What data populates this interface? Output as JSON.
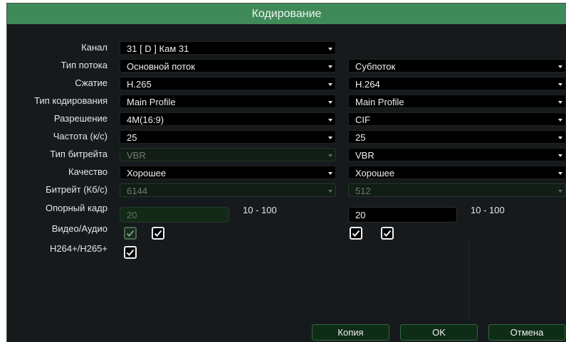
{
  "dialog": {
    "title": "Кодирование"
  },
  "labels": {
    "channel": "Канал",
    "stream_type": "Тип потока",
    "compression": "Сжатие",
    "encoding_type": "Тип кодирования",
    "resolution": "Разрешение",
    "frame_rate": "Частота (к/с)",
    "bitrate_type": "Тип битрейта",
    "quality": "Качество",
    "bitrate": "Битрейт (Кб/с)",
    "key_frame": "Опорный кадр",
    "video_audio": "Видео/Аудио",
    "h264plus": "H264+/H265+"
  },
  "channel": {
    "value": "31 [ D ] Кам 31"
  },
  "main": {
    "stream_type": "Основной поток",
    "compression": "H.265",
    "encoding_type": "Main Profile",
    "resolution": "4M(16:9)",
    "frame_rate": "25",
    "bitrate_type": "VBR",
    "quality": "Хорошее",
    "bitrate": "6144",
    "key_frame": "20",
    "key_frame_range": "10 - 100",
    "video_checked": true,
    "audio_checked": true,
    "h264plus_checked": true
  },
  "sub": {
    "stream_type": "Субпоток",
    "compression": "H.264",
    "encoding_type": "Main Profile",
    "resolution": "CIF",
    "frame_rate": "25",
    "bitrate_type": "VBR",
    "quality": "Хорошее",
    "bitrate": "512",
    "key_frame": "20",
    "key_frame_range": "10 - 100",
    "video_checked": true,
    "audio_checked": true
  },
  "buttons": {
    "copy": "Копия",
    "ok": "OK",
    "cancel": "Отмена"
  },
  "colors": {
    "title_bar": "#3f8a58",
    "background": "#171a1d",
    "button_bg": "#0e2c16"
  }
}
